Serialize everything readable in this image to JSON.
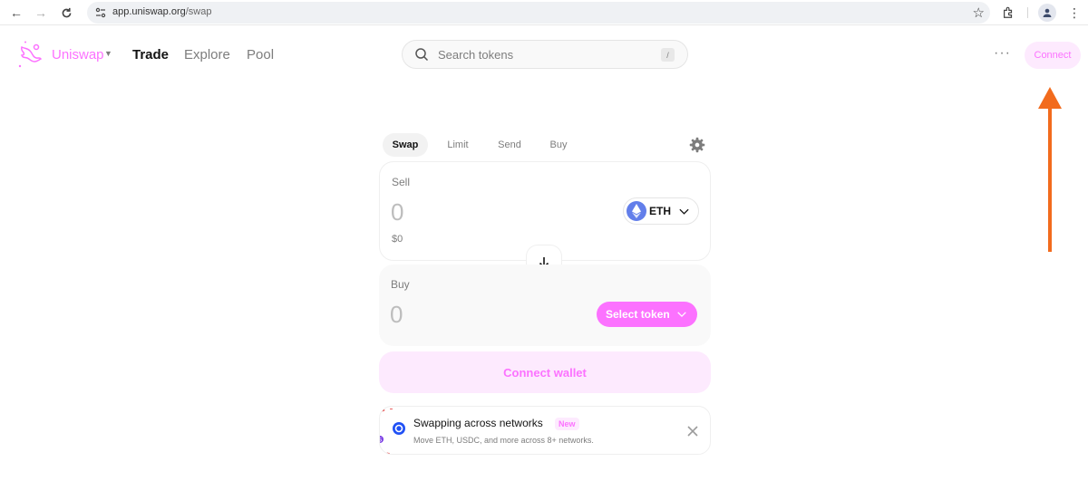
{
  "browser": {
    "url_host": "app.uniswap.org",
    "url_path": "/swap"
  },
  "header": {
    "brand": "Uniswap",
    "nav": [
      "Trade",
      "Explore",
      "Pool"
    ],
    "search_placeholder": "Search tokens",
    "search_shortcut": "/",
    "more": "···",
    "connect": "Connect"
  },
  "swap": {
    "tabs": [
      "Swap",
      "Limit",
      "Send",
      "Buy"
    ],
    "sell": {
      "label": "Sell",
      "amount": "0",
      "usd": "$0",
      "token": "ETH"
    },
    "buy": {
      "label": "Buy",
      "amount": "0",
      "select_token": "Select token"
    },
    "connect_wallet": "Connect wallet"
  },
  "banner": {
    "title": "Swapping across networks",
    "badge": "New",
    "subtitle": "Move ETH, USDC, and more across 8+ networks."
  },
  "colors": {
    "accent": "#fc72ff",
    "accent_soft": "#fdeafe",
    "annotation_arrow": "#f26b1d",
    "eth": "#627eea"
  }
}
